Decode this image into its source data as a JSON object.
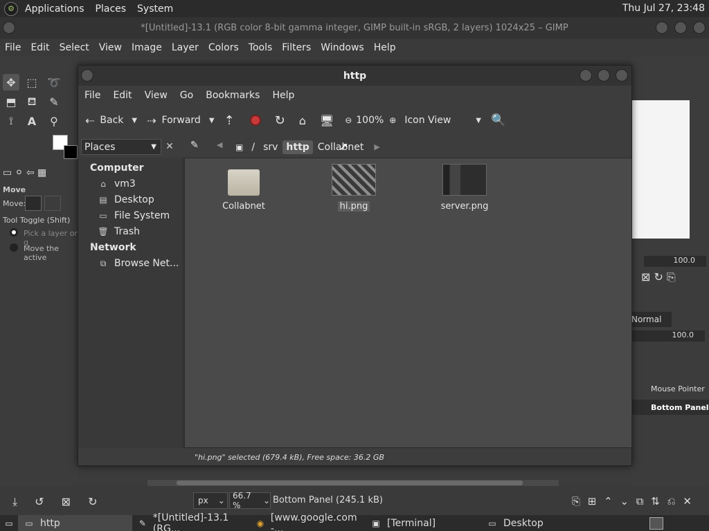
{
  "topbar": {
    "menus": [
      "Applications",
      "Places",
      "System"
    ],
    "clock": "Thu Jul 27, 23:48"
  },
  "gimp": {
    "title": "*[Untitled]-13.1 (RGB color 8-bit gamma integer, GIMP built-in sRGB, 2 layers) 1024x25 – GIMP",
    "menus": [
      "File",
      "Edit",
      "Select",
      "View",
      "Image",
      "Layer",
      "Colors",
      "Tools",
      "Filters",
      "Windows",
      "Help"
    ],
    "tool_options": {
      "title": "Move",
      "move_label": "Move:",
      "toggle_label": "Tool Toggle (Shift)",
      "option1": "Pick a layer or g",
      "option2": "Move the active"
    },
    "right_dock": {
      "opacity1": "100.0",
      "mode": "Normal",
      "opacity2": "100.0",
      "layers": [
        "Mouse Pointer",
        "Bottom Panel"
      ]
    },
    "statusbar": {
      "unit": "px",
      "zoom": "66.7 %",
      "layer_info": "Bottom Panel (245.1 kB)"
    }
  },
  "taskbar": {
    "items": [
      {
        "label": "http",
        "icon": "folder-icon"
      },
      {
        "label": "*[Untitled]-13.1 (RG...",
        "icon": "gimp-icon"
      },
      {
        "label": "[www.google.com -...",
        "icon": "chrome-icon"
      },
      {
        "label": "[Terminal]",
        "icon": "terminal-icon"
      },
      {
        "label": "Desktop",
        "icon": "folder-icon"
      }
    ]
  },
  "fm": {
    "title": "http",
    "menus": [
      "File",
      "Edit",
      "View",
      "Go",
      "Bookmarks",
      "Help"
    ],
    "toolbar": {
      "back": "Back",
      "forward": "Forward",
      "zoom": "100%",
      "view_mode": "Icon View"
    },
    "places_label": "Places",
    "crumbs": [
      "/",
      "srv",
      "http",
      "Collabnet"
    ],
    "sidebar": {
      "computer_head": "Computer",
      "computer_items": [
        "vm3",
        "Desktop",
        "File System",
        "Trash"
      ],
      "network_head": "Network",
      "network_items": [
        "Browse Net..."
      ]
    },
    "files": [
      {
        "name": "Collabnet",
        "type": "folder"
      },
      {
        "name": "hi.png",
        "type": "image"
      },
      {
        "name": "server.png",
        "type": "image"
      }
    ],
    "status": "\"hi.png\" selected (679.4 kB), Free space: 36.2 GB"
  }
}
